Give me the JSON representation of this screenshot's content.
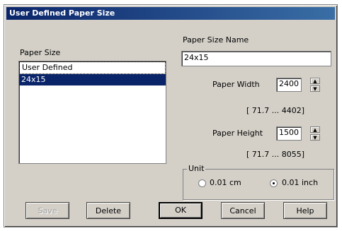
{
  "window": {
    "title": "User Defined Paper Size"
  },
  "paper_size": {
    "label": "Paper Size",
    "items": [
      {
        "label": "User Defined"
      },
      {
        "label": "24x15"
      }
    ]
  },
  "paper_size_name": {
    "label": "Paper Size Name",
    "value": "24x15"
  },
  "paper_width": {
    "label": "Paper Width",
    "value": "2400",
    "range": "[ 71.7 ...  4402]"
  },
  "paper_height": {
    "label": "Paper Height",
    "value": "1500",
    "range": "[ 71.7 ...  8055]"
  },
  "unit": {
    "label": "Unit",
    "options": [
      {
        "label": "0.01 cm",
        "selected": false
      },
      {
        "label": "0.01 inch",
        "selected": true
      }
    ]
  },
  "buttons": {
    "save": "Save",
    "delete": "Delete",
    "ok": "OK",
    "cancel": "Cancel",
    "help": "Help"
  }
}
